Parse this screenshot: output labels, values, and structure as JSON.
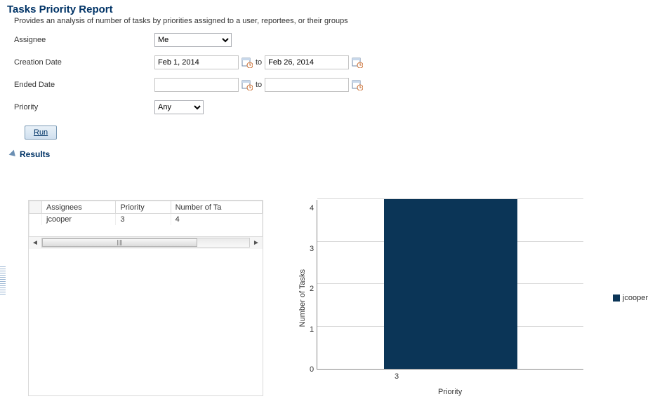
{
  "title": "Tasks Priority Report",
  "subtitle": "Provides an analysis of number of tasks by priorities assigned to a user, reportees, or their groups",
  "form": {
    "assignee_label": "Assignee",
    "assignee_value": "Me",
    "creation_label": "Creation Date",
    "creation_from": "Feb 1, 2014",
    "creation_to": "Feb 26, 2014",
    "ended_label": "Ended Date",
    "ended_from": "",
    "ended_to": "",
    "to_label": "to",
    "priority_label": "Priority",
    "priority_value": "Any",
    "run_label": "Run"
  },
  "results": {
    "header": "Results",
    "columns": [
      "Assignees",
      "Priority",
      "Number of Tasks"
    ],
    "column3_truncated": "Number of Ta",
    "rows": [
      {
        "assignee": "jcooper",
        "priority": "3",
        "count": "4"
      }
    ]
  },
  "chart_data": {
    "type": "bar",
    "title": "",
    "xlabel": "Priority",
    "ylabel": "Number of Tasks",
    "categories": [
      "3"
    ],
    "series": [
      {
        "name": "jcooper",
        "values": [
          4
        ]
      }
    ],
    "ylim": [
      0,
      4
    ],
    "yticks": [
      0,
      1,
      2,
      3,
      4
    ],
    "legend_position": "right",
    "colors": {
      "jcooper": "#0b3557"
    }
  }
}
